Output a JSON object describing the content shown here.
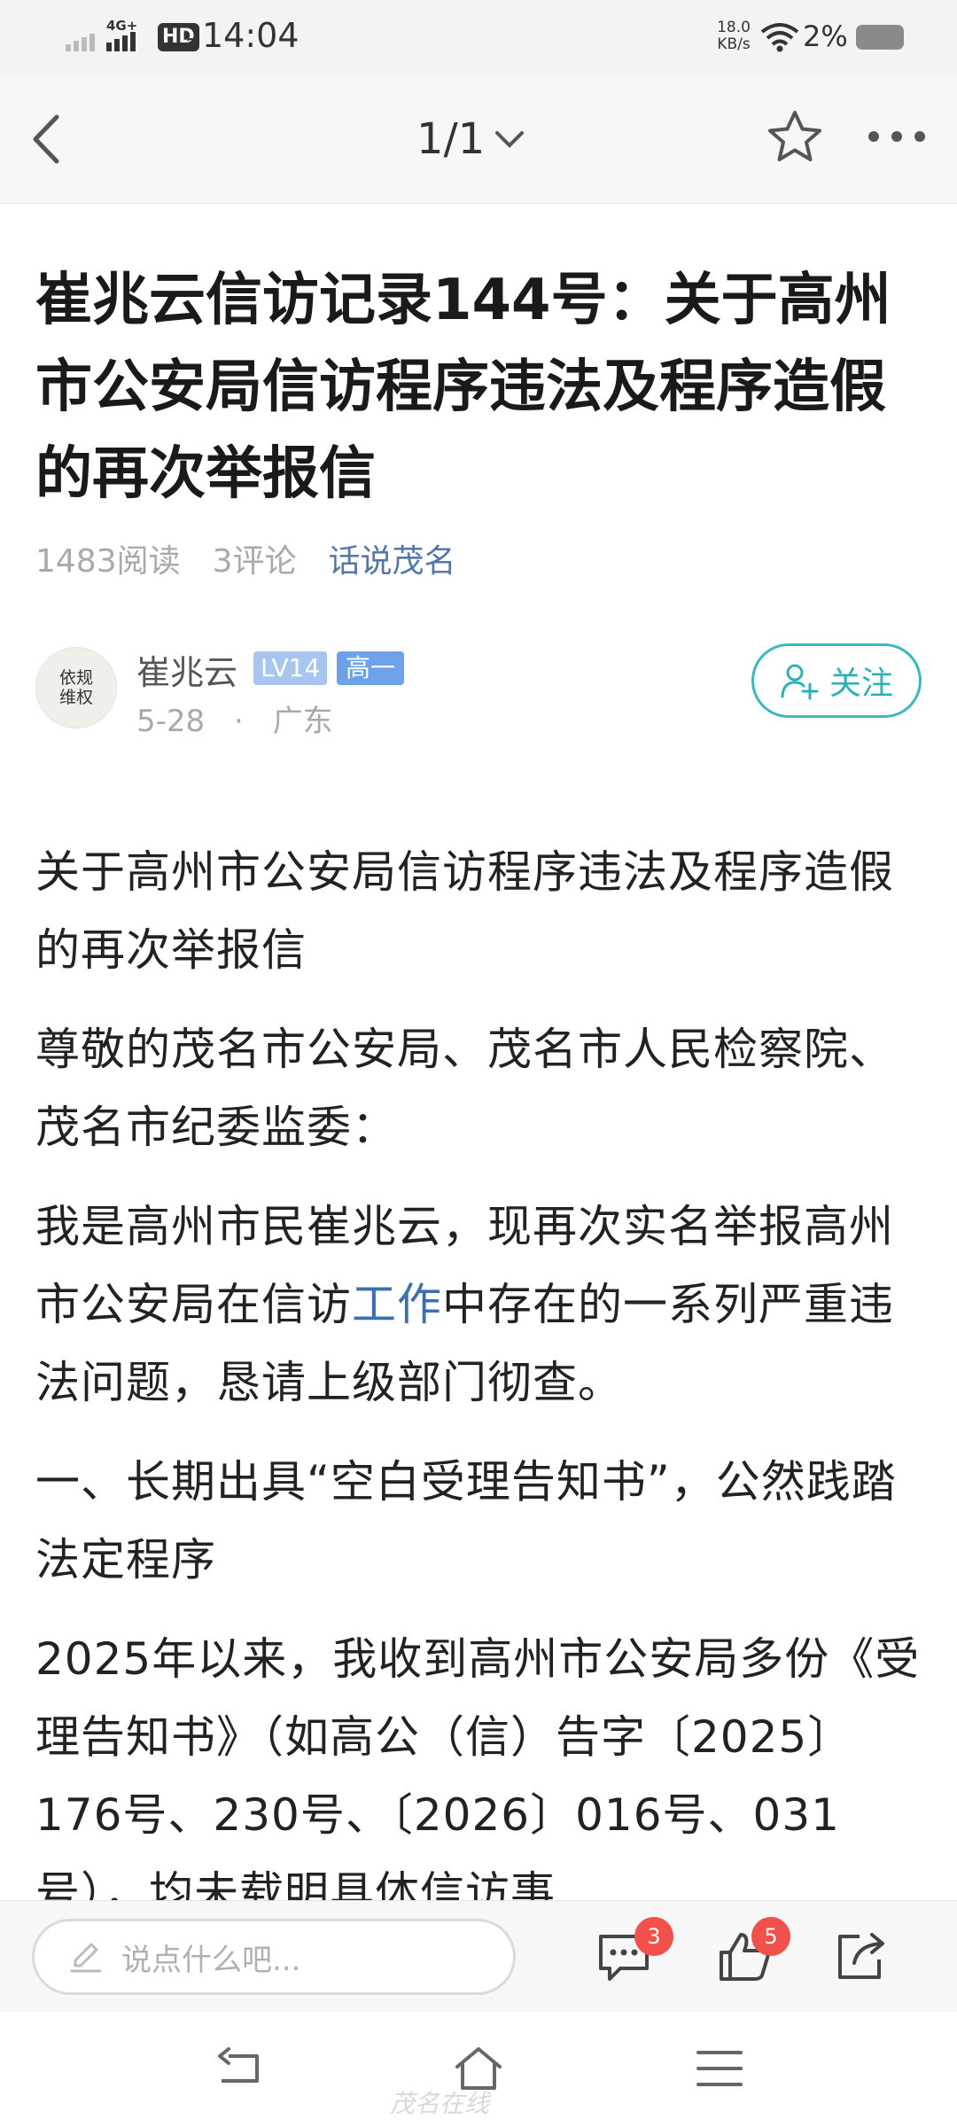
{
  "status_bar": {
    "network": "4G+",
    "hd": "HD",
    "hd_sub": "2",
    "time": "14:04",
    "speed_value": "18.0",
    "speed_unit": "KB/s",
    "battery_text": "2%"
  },
  "header": {
    "page_indicator": "1/1"
  },
  "article": {
    "title": "崔兆云信访记录144号：关于高州市公安局信访程序违法及程序造假的再次举报信",
    "reads": "1483阅读",
    "comments": "3评论",
    "forum": "话说茂名"
  },
  "author": {
    "avatar_line1": "依规",
    "avatar_line2": "维权",
    "name": "崔兆云",
    "level": "LV14",
    "grade": "高一",
    "date": "5-28",
    "dot": "·",
    "location": "广东",
    "follow_label": "关注"
  },
  "content": {
    "p1": "关于高州市公安局信访程序违法及程序造假的再次举报信",
    "p2": "尊敬的茂名市公安局、茂名市人民检察院、茂名市纪委监委：",
    "p3_before": "我是高州市民崔兆云，现再次实名举报高州市公安局在信访",
    "p3_link": "工作",
    "p3_after": "中存在的一系列严重违法问题，恳请上级部门彻查。",
    "p4": "一、长期出具“空白受理告知书”，公然践踏法定程序",
    "p5": "2025年以来，我收到高州市公安局多份《受理告知书》（如高公（信）告字〔2025〕176号、230号、〔2026〕016号、031号），均未载明具体信访事"
  },
  "comment_bar": {
    "placeholder": "说点什么吧...",
    "comment_count": "3",
    "like_count": "5"
  },
  "watermark": "茂名在线"
}
